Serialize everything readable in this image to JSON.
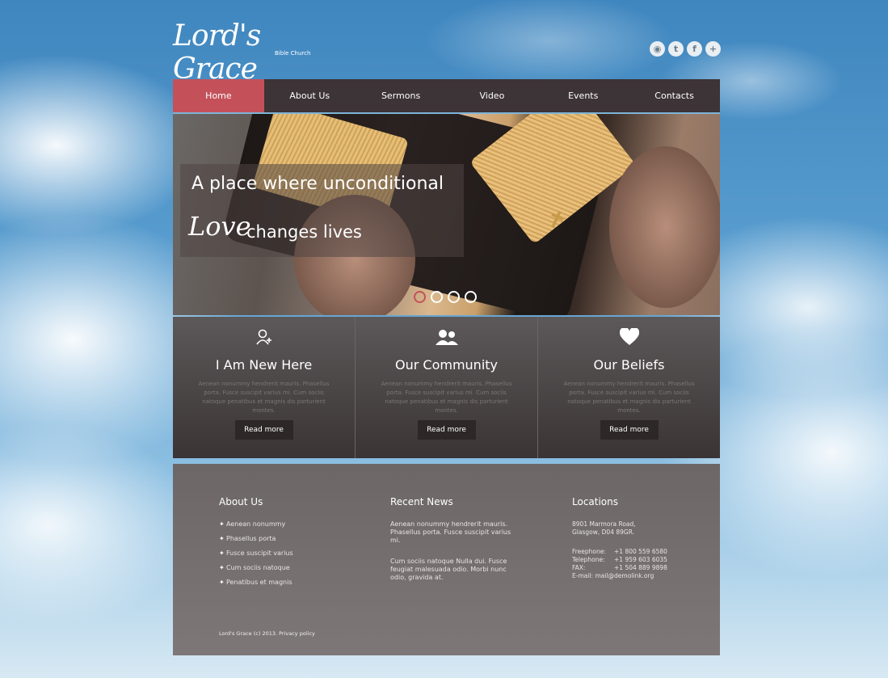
{
  "logo": {
    "name": "Lord's Grace",
    "subtitle": "Bible Church"
  },
  "social": [
    {
      "name": "rss-icon",
      "glyph": "◉"
    },
    {
      "name": "twitter-icon",
      "glyph": "t"
    },
    {
      "name": "facebook-icon",
      "glyph": "f"
    },
    {
      "name": "plus-icon",
      "glyph": "+"
    }
  ],
  "nav": {
    "items": [
      "Home",
      "About Us",
      "Sermons",
      "Video",
      "Events",
      "Contacts"
    ],
    "active": "Home"
  },
  "hero": {
    "line1": "A place where unconditional",
    "love": "Love",
    "line2": "changes lives",
    "slides": 4,
    "active_slide": 1
  },
  "features": [
    {
      "icon": "add-user-icon",
      "title": "I Am New Here",
      "text": "Aenean nonummy hendrerit mauris. Phasellus porta. Fusce suscipit varius mi. Cum sociis natoque penatibus et magnis dis parturient montes.",
      "button": "Read more"
    },
    {
      "icon": "users-icon",
      "title": "Our Community",
      "text": "Aenean nonummy hendrerit mauris. Phasellus porta. Fusce suscipit varius mi. Cum sociis natoque penatibus et magnis dis parturient montes.",
      "button": "Read more"
    },
    {
      "icon": "heart-icon",
      "title": "Our Beliefs",
      "text": "Aenean nonummy hendrerit mauris. Phasellus porta. Fusce suscipit varius mi. Cum sociis natoque penatibus et magnis dis parturient montes.",
      "button": "Read more"
    }
  ],
  "footer": {
    "about": {
      "title": "About Us",
      "items": [
        "Aenean nonummy",
        "Phasellus porta",
        "Fusce suscipit varius",
        "Cum sociis natoque",
        "Penatibus et magnis"
      ]
    },
    "news": {
      "title": "Recent News",
      "items": [
        "Aenean nonummy hendrerit mauris. Phasellus porta. Fusce suscipit varius mi.",
        "Cum sociis natoque Nulla dui. Fusce feugiat malesuada odio. Morbi nunc odio, gravida at."
      ]
    },
    "locations": {
      "title": "Locations",
      "address1": "8901 Marmora Road,",
      "address2": "Glasgow, D04 89GR.",
      "freephone_label": "Freephone:",
      "freephone": "+1 800 559 6580",
      "telephone_label": "Telephone:",
      "telephone": "+1 959 603 6035",
      "fax_label": "FAX:",
      "fax": "+1 504 889 9898",
      "email_label": "E-mail:",
      "email": "mail@demolink.org"
    },
    "copyright": "Lord's Grace (c) 2013. Privacy policy"
  }
}
